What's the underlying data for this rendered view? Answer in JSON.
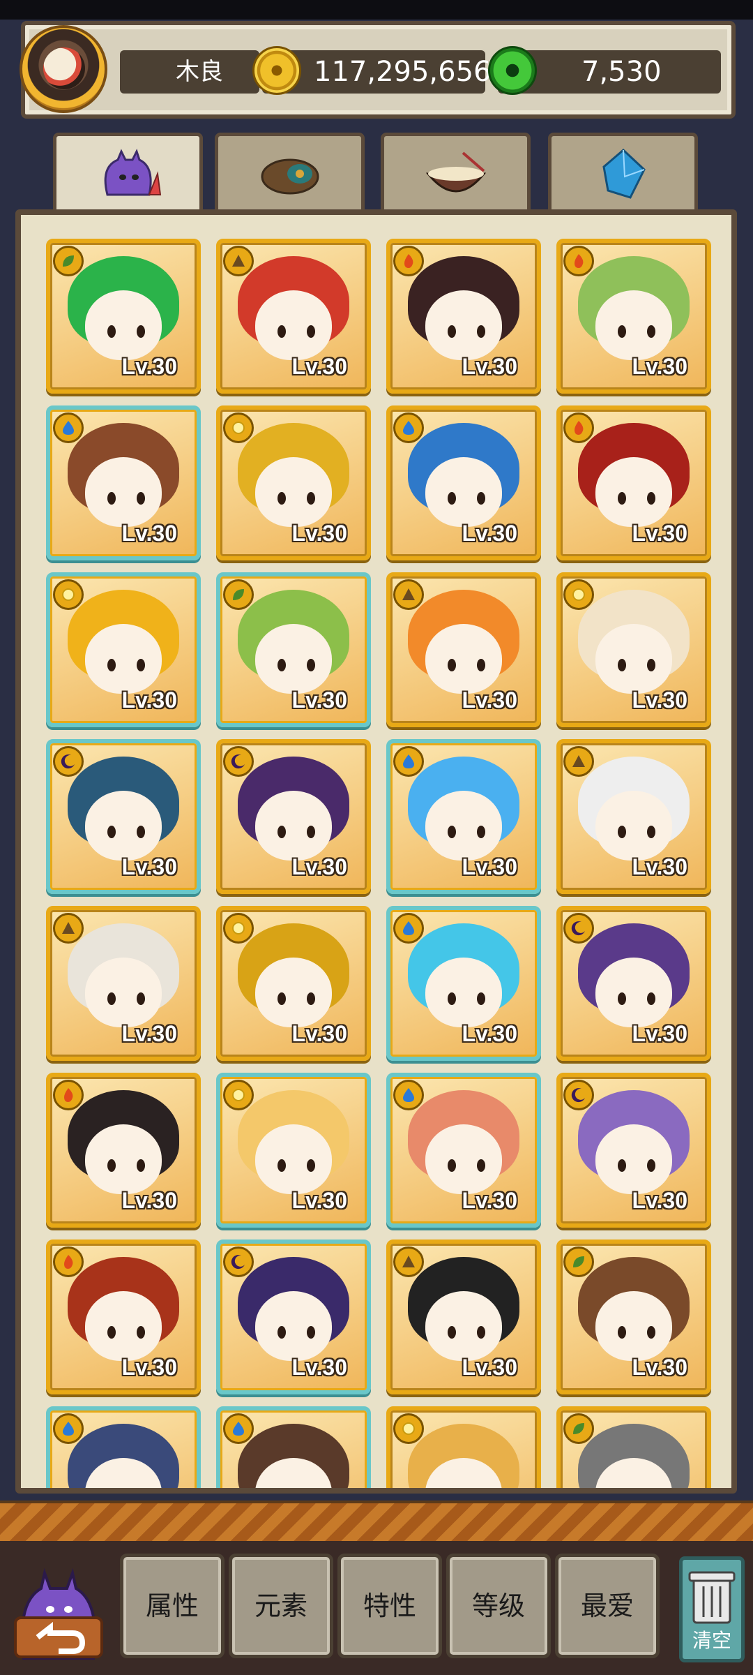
{
  "header": {
    "player_name": "木良",
    "gold": "117,295,656",
    "gems": "7,530"
  },
  "tabs": [
    {
      "icon": "monster-icon",
      "active": true
    },
    {
      "icon": "pinecone-icon",
      "active": false
    },
    {
      "icon": "ramen-bowl-icon",
      "active": false
    },
    {
      "icon": "crystal-icon",
      "active": false
    }
  ],
  "colors": {
    "card_gold": "#e8a916",
    "card_teal": "#69c7c9",
    "panel_bg": "#e8e1c8",
    "wood": "#c77a2a"
  },
  "cards": [
    {
      "element": "leaf-icon",
      "level": "Lv.30",
      "hair": "#2bb34a"
    },
    {
      "element": "earth-icon",
      "level": "Lv.30",
      "hair": "#d23a2a"
    },
    {
      "element": "fire-icon",
      "level": "Lv.30",
      "hair": "#3a2222"
    },
    {
      "element": "fire-icon",
      "level": "Lv.30",
      "hair": "#8fc05a"
    },
    {
      "element": "water-icon",
      "level": "Lv.30",
      "hair": "#8a4a2a"
    },
    {
      "element": "light-icon",
      "level": "Lv.30",
      "hair": "#e2b022"
    },
    {
      "element": "water-icon",
      "level": "Lv.30",
      "hair": "#2f79c9"
    },
    {
      "element": "fire-icon",
      "level": "Lv.30",
      "hair": "#a8211a"
    },
    {
      "element": "light-icon",
      "level": "Lv.30",
      "hair": "#f0b21a"
    },
    {
      "element": "leaf-icon",
      "level": "Lv.30",
      "hair": "#8cbf4a"
    },
    {
      "element": "earth-icon",
      "level": "Lv.30",
      "hair": "#f28a2a"
    },
    {
      "element": "light-icon",
      "level": "Lv.30",
      "hair": "#f2e3c8"
    },
    {
      "element": "dark-icon",
      "level": "Lv.30",
      "hair": "#2a5a7a"
    },
    {
      "element": "dark-icon",
      "level": "Lv.30",
      "hair": "#4a2a6a"
    },
    {
      "element": "water-icon",
      "level": "Lv.30",
      "hair": "#4ab0f0"
    },
    {
      "element": "earth-icon",
      "level": "Lv.30",
      "hair": "#eeeeee"
    },
    {
      "element": "earth-icon",
      "level": "Lv.30",
      "hair": "#e9e4da"
    },
    {
      "element": "light-icon",
      "level": "Lv.30",
      "hair": "#d8a316"
    },
    {
      "element": "water-icon",
      "level": "Lv.30",
      "hair": "#44c6e8"
    },
    {
      "element": "dark-icon",
      "level": "Lv.30",
      "hair": "#5a3a8a"
    },
    {
      "element": "fire-icon",
      "level": "Lv.30",
      "hair": "#2a2222"
    },
    {
      "element": "light-icon",
      "level": "Lv.30",
      "hair": "#f4c86a"
    },
    {
      "element": "water-icon",
      "level": "Lv.30",
      "hair": "#e88a6a"
    },
    {
      "element": "dark-icon",
      "level": "Lv.30",
      "hair": "#8a6ac0"
    },
    {
      "element": "fire-icon",
      "level": "Lv.30",
      "hair": "#a8331a"
    },
    {
      "element": "dark-icon",
      "level": "Lv.30",
      "hair": "#3a2a6a"
    },
    {
      "element": "earth-icon",
      "level": "Lv.30",
      "hair": "#222222"
    },
    {
      "element": "leaf-icon",
      "level": "Lv.30",
      "hair": "#7a4a2a"
    },
    {
      "element": "water-icon",
      "level": "",
      "hair": "#3a4a7a"
    },
    {
      "element": "water-icon",
      "level": "",
      "hair": "#5a3a2a"
    },
    {
      "element": "light-icon",
      "level": "",
      "hair": "#e8b04a"
    },
    {
      "element": "leaf-icon",
      "level": "",
      "hair": "#777777"
    }
  ],
  "filters": [
    "属性",
    "元素",
    "特性",
    "等级",
    "最爱"
  ],
  "clear_label": "清空"
}
